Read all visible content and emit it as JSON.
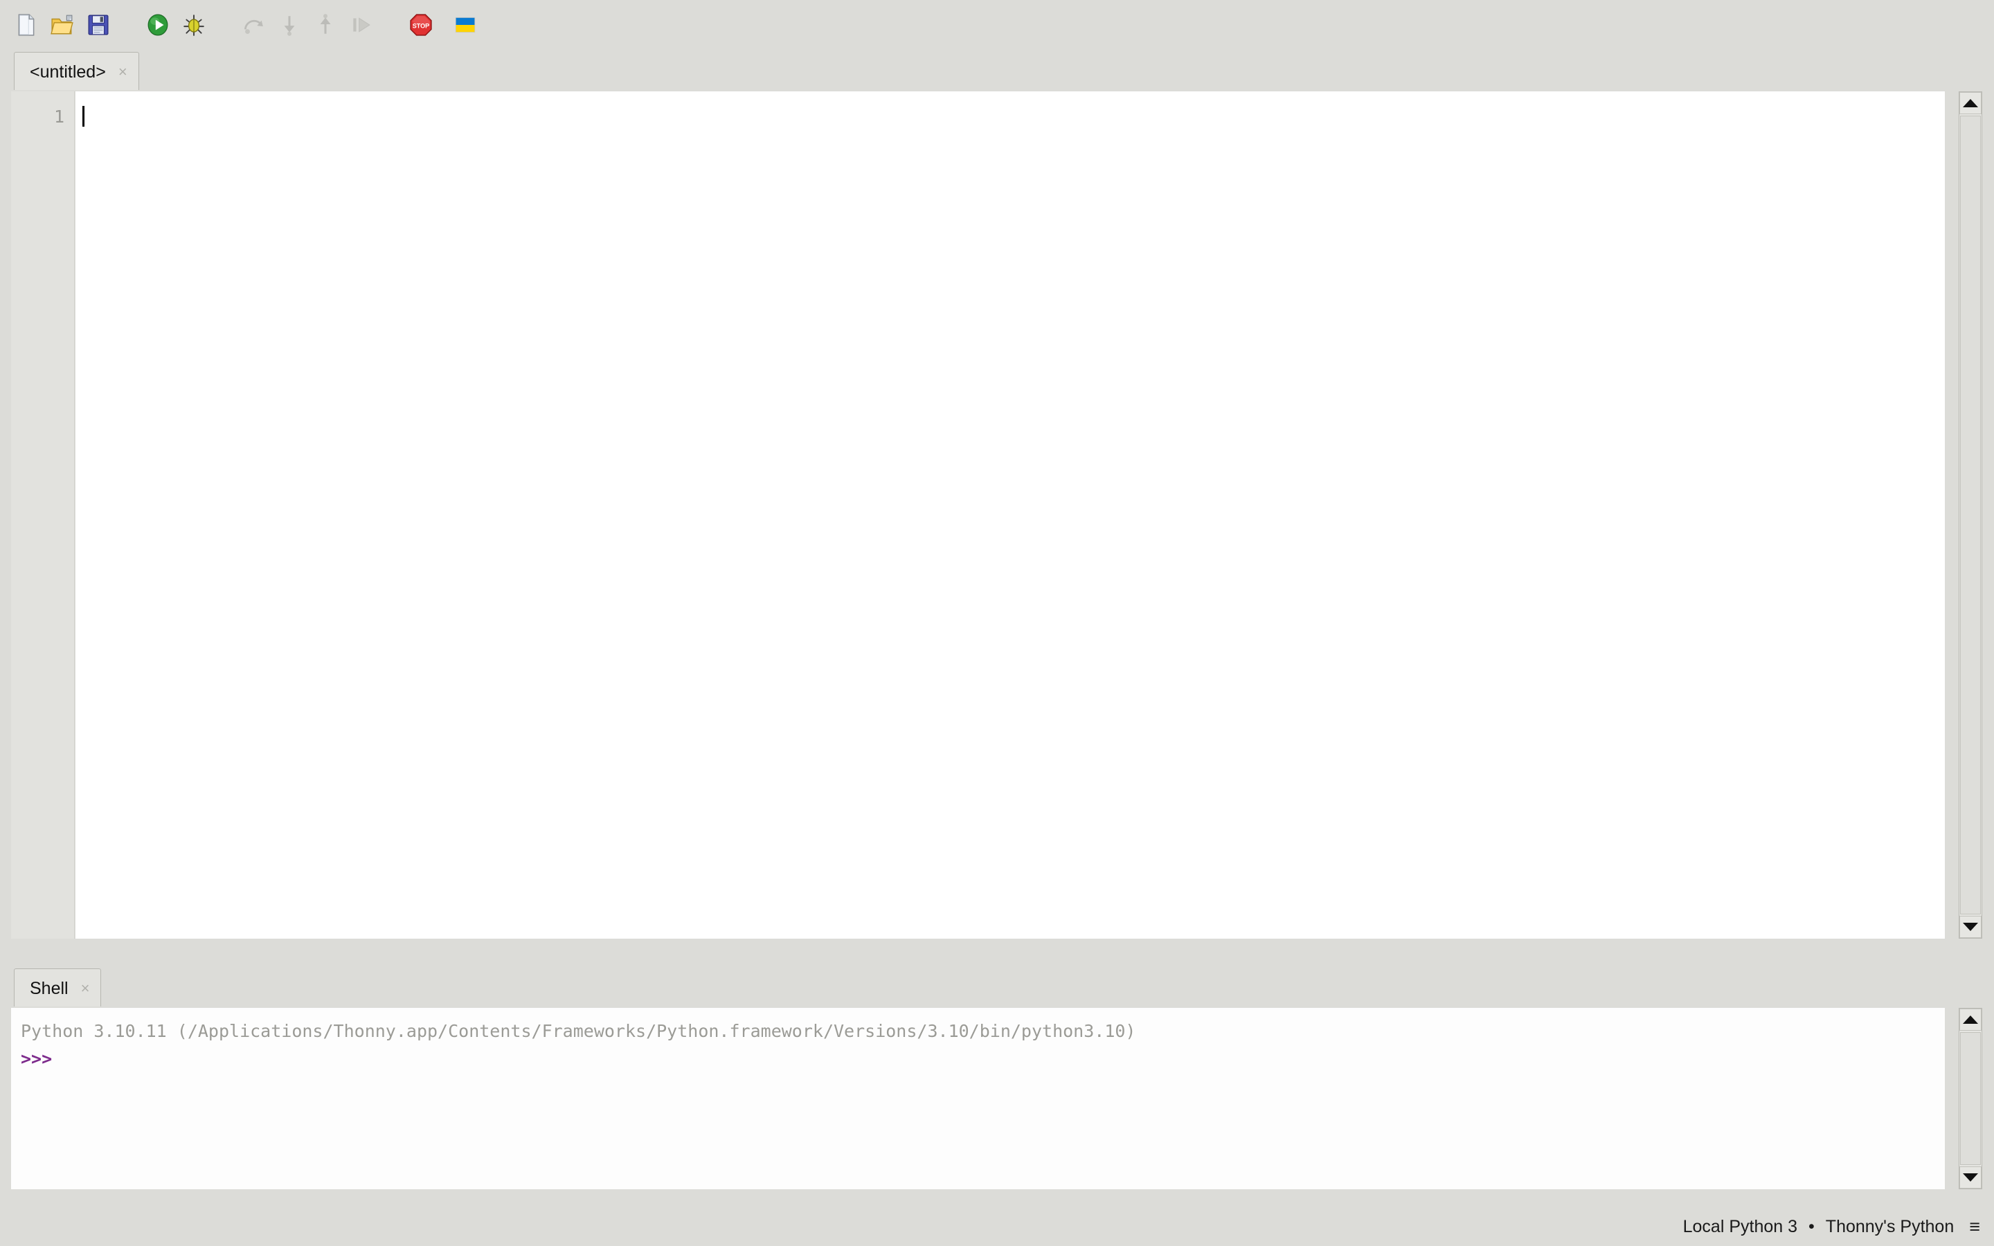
{
  "app": {
    "name": "Thonny"
  },
  "toolbar": {
    "buttons": [
      {
        "name": "new-file-icon",
        "label": "New",
        "enabled": true
      },
      {
        "name": "open-file-icon",
        "label": "Load",
        "enabled": true
      },
      {
        "name": "save-file-icon",
        "label": "Save",
        "enabled": true
      },
      {
        "name": "run-icon",
        "label": "Run current script",
        "enabled": true
      },
      {
        "name": "debug-icon",
        "label": "Debug current script",
        "enabled": true
      },
      {
        "name": "step-over-icon",
        "label": "Step over",
        "enabled": false
      },
      {
        "name": "step-into-icon",
        "label": "Step into",
        "enabled": false
      },
      {
        "name": "step-out-icon",
        "label": "Step out",
        "enabled": false
      },
      {
        "name": "resume-icon",
        "label": "Resume",
        "enabled": false
      },
      {
        "name": "stop-icon",
        "label": "Stop/Restart backend",
        "enabled": true
      },
      {
        "name": "ukraine-flag-icon",
        "label": "Support Ukraine",
        "enabled": true
      }
    ]
  },
  "editor": {
    "tab": {
      "label": "<untitled>",
      "close": "×"
    },
    "line_numbers": [
      "1"
    ],
    "content": "",
    "caret_line": 1
  },
  "shell": {
    "tab": {
      "label": "Shell",
      "close": "×"
    },
    "banner": "Python 3.10.11 (/Applications/Thonny.app/Contents/Frameworks/Python.framework/Versions/3.10/bin/python3.10)",
    "prompt": ">>>"
  },
  "statusbar": {
    "interpreter": "Local Python 3",
    "separator": "•",
    "variant": "Thonny's Python",
    "menu_icon": "≡"
  },
  "colors": {
    "window_bg": "#dcdcd8",
    "editor_bg": "#ffffff",
    "gutter_bg": "#e2e2de",
    "shell_bg": "#fdfdfd",
    "banner_text": "#9b9b96",
    "prompt_text": "#7d2b8c",
    "tab_active_bg": "#e3e3df",
    "border": "#b6b6b0"
  }
}
